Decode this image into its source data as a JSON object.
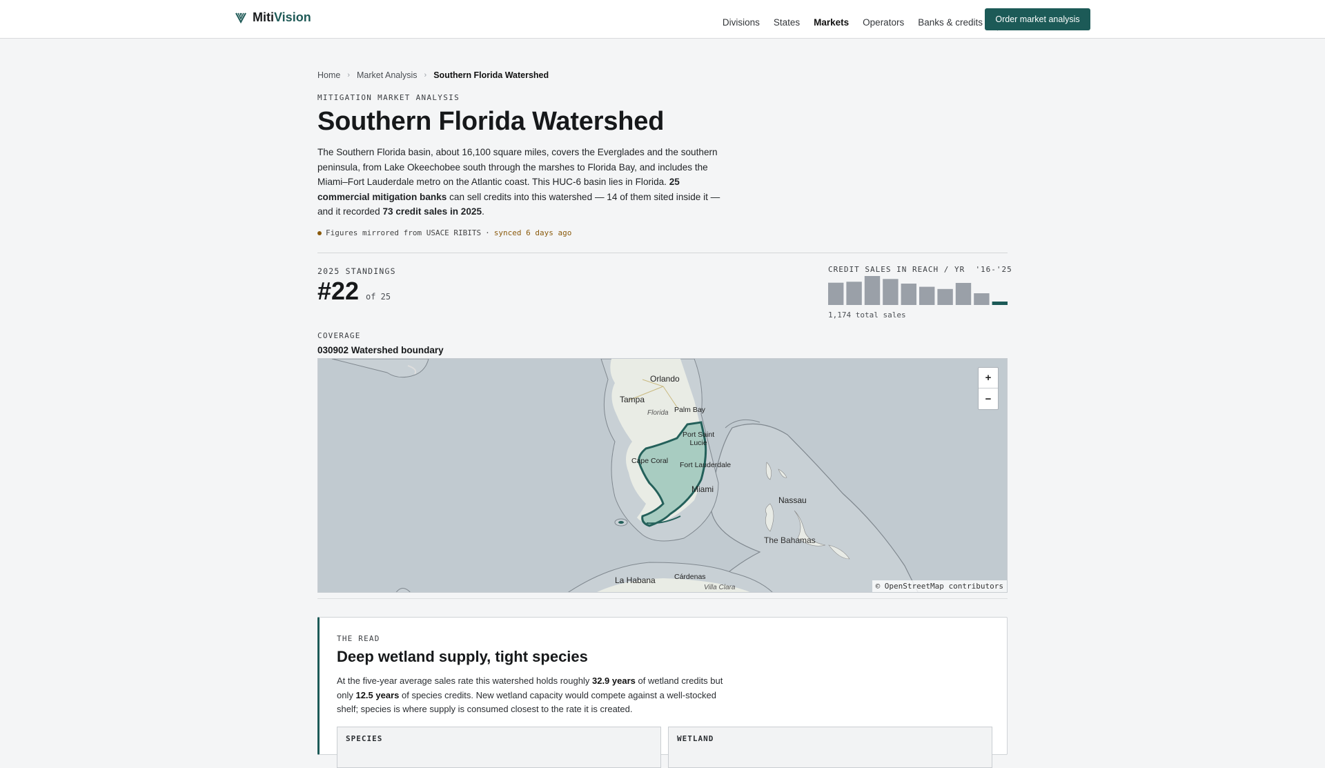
{
  "brand": {
    "name_1": "Miti",
    "name_2": "Vision"
  },
  "nav": {
    "items": [
      "Divisions",
      "States",
      "Markets",
      "Operators",
      "Banks & credits"
    ],
    "active": "Markets",
    "cta_label": "Order market analysis"
  },
  "breadcrumb": [
    "Home",
    "Market Analysis",
    "Southern Florida Watershed"
  ],
  "eyebrow": "MITIGATION MARKET ANALYSIS",
  "title": "Southern Florida Watershed",
  "intro": {
    "p1": "The Southern Florida basin, about 16,100 square miles, covers the Everglades and the southern peninsula, from Lake Okeechobee south through the marshes to Florida Bay, and includes the Miami–Fort Lauderdale metro on the Atlantic coast. This HUC-6 basin lies in Florida. ",
    "b1": "25 commercial mitigation banks",
    "p2": " can sell credits into this watershed — 14 of them sited inside it — and it recorded ",
    "b2": "73 credit sales in 2025",
    "p3": "."
  },
  "sync": {
    "source": "Figures mirrored from USACE RIBITS",
    "sep": "·",
    "ago": "synced 6 days ago"
  },
  "standings": {
    "label": "2025 STANDINGS",
    "rank": "#22",
    "of": "of 25"
  },
  "credit_sales": {
    "label": "CREDIT SALES IN REACH / YR",
    "range": "'16-'25",
    "total": "1,174 total sales",
    "bar_color": "#9aa0a8",
    "highlight_color": "#1c5a57"
  },
  "chart_data": {
    "type": "bar",
    "categories": [
      "2016",
      "2017",
      "2018",
      "2019",
      "2020",
      "2021",
      "2022",
      "2023",
      "2024",
      "2025"
    ],
    "values": [
      120,
      125,
      156,
      140,
      115,
      98,
      86,
      119,
      63,
      18
    ],
    "title": "CREDIT SALES IN REACH / YR",
    "xlabel": "",
    "ylabel": ""
  },
  "coverage": {
    "label": "COVERAGE",
    "code": "030902",
    "name": "Watershed boundary"
  },
  "map": {
    "labels": {
      "orlando": "Orlando",
      "tampa": "Tampa",
      "florida": "Florida",
      "palm_bay": "Palm Bay",
      "port_saint_lucie_1": "Port Saint",
      "port_saint_lucie_2": "Lucie",
      "cape_coral": "Cape Coral",
      "fort_lauderdale": "Fort Lauderdale",
      "miami": "Miami",
      "nassau": "Nassau",
      "bahamas": "The Bahamas",
      "la_habana": "La Habana",
      "cardenas": "Cárdenas",
      "villa_clara": "Villa Clara"
    },
    "zoom_in": "+",
    "zoom_out": "−",
    "attribution": "© OpenStreetMap contributors"
  },
  "read": {
    "label": "THE READ",
    "title": "Deep wetland supply, tight species",
    "t1": "At the five-year average sales rate this watershed holds roughly ",
    "b1": "32.9 years",
    "t2": " of wetland credits but only ",
    "b2": "12.5 years",
    "t3": " of species credits. New wetland capacity would compete against a well-stocked shelf; species is where supply is consumed closest to the rate it is created.",
    "species_label": "SPECIES",
    "wetland_label": "WETLAND"
  }
}
